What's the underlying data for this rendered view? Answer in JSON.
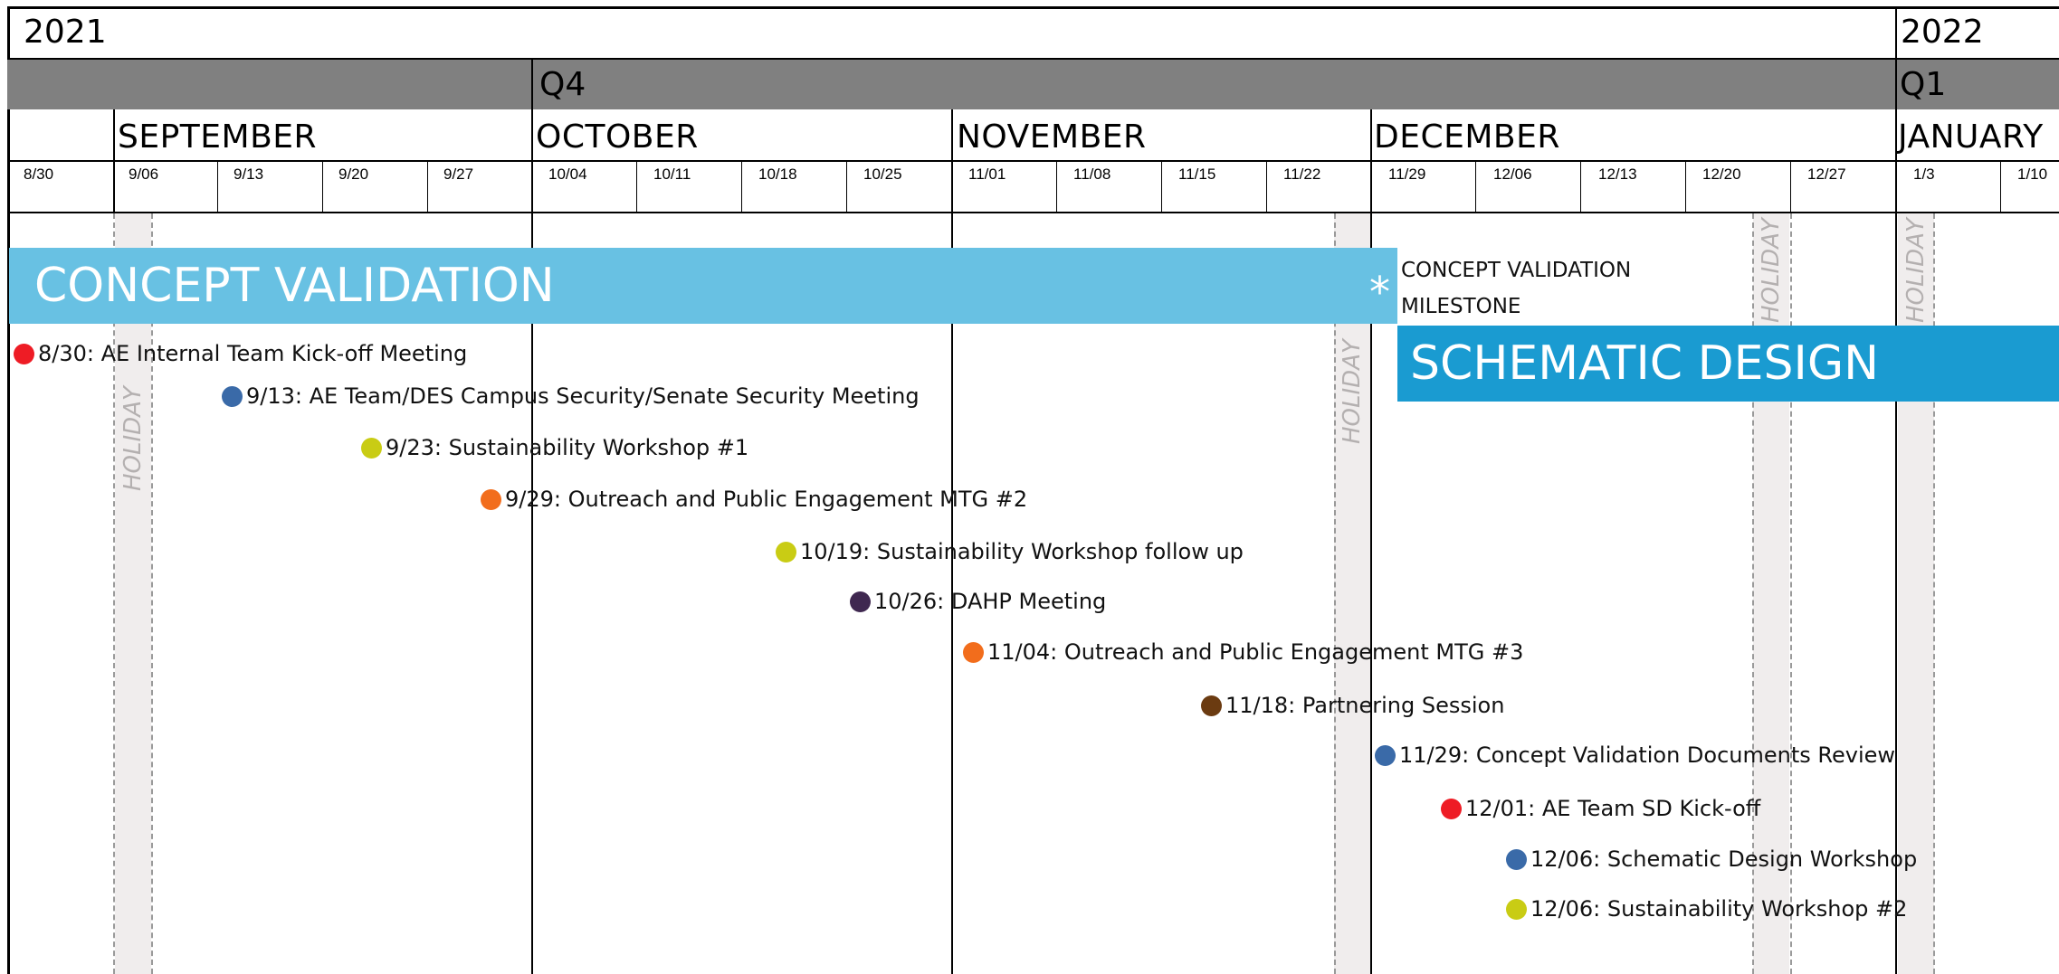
{
  "years": [
    {
      "label": "2021"
    },
    {
      "label": "2022"
    }
  ],
  "quarters": [
    {
      "label": "Q4"
    },
    {
      "label": "Q1"
    }
  ],
  "months": [
    {
      "label": "SEPTEMBER"
    },
    {
      "label": "OCTOBER"
    },
    {
      "label": "NOVEMBER"
    },
    {
      "label": "DECEMBER"
    },
    {
      "label": "JANUARY"
    }
  ],
  "weeks": [
    "8/30",
    "9/06",
    "9/13",
    "9/20",
    "9/27",
    "10/04",
    "10/11",
    "10/18",
    "10/25",
    "11/01",
    "11/08",
    "11/15",
    "11/22",
    "11/29",
    "12/06",
    "12/13",
    "12/20",
    "12/27",
    "1/3",
    "1/10"
  ],
  "phases": [
    {
      "label": "CONCEPT VALIDATION",
      "color": "#68c1e3"
    },
    {
      "label": "SCHEMATIC DESIGN",
      "color": "#1a9bd1"
    }
  ],
  "milestone": {
    "symbol": "*",
    "line1": "CONCEPT VALIDATION",
    "line2": "MILESTONE"
  },
  "holiday_label": "HOLIDAY",
  "colors": {
    "red": "#ee1c25",
    "blue": "#3a6aa8",
    "yellow": "#c9cc14",
    "orange": "#f26d1c",
    "purple": "#3f2850",
    "brown": "#6b3b11",
    "holiday_band": "#f0eded",
    "grid": "#000000",
    "quarter_band": "#808080"
  },
  "events": [
    {
      "label": "8/30: AE Internal Team Kick-off Meeting",
      "color": "red"
    },
    {
      "label": "9/13: AE Team/DES Campus Security/Senate Security Meeting",
      "color": "blue"
    },
    {
      "label": "9/23: Sustainability Workshop #1",
      "color": "yellow"
    },
    {
      "label": "9/29: Outreach and Public Engagement MTG #2",
      "color": "orange"
    },
    {
      "label": "10/19: Sustainability Workshop follow up",
      "color": "yellow"
    },
    {
      "label": "10/26: DAHP Meeting",
      "color": "purple"
    },
    {
      "label": "11/04: Outreach and Public Engagement MTG #3",
      "color": "orange"
    },
    {
      "label": "11/18: Partnering Session",
      "color": "brown"
    },
    {
      "label": "11/29: Concept Validation Documents Review",
      "color": "blue"
    },
    {
      "label": "12/01: AE Team SD Kick-off",
      "color": "red"
    },
    {
      "label": "12/06: Schematic Design Workshop",
      "color": "blue"
    },
    {
      "label": "12/06: Sustainability Workshop #2",
      "color": "yellow"
    }
  ]
}
